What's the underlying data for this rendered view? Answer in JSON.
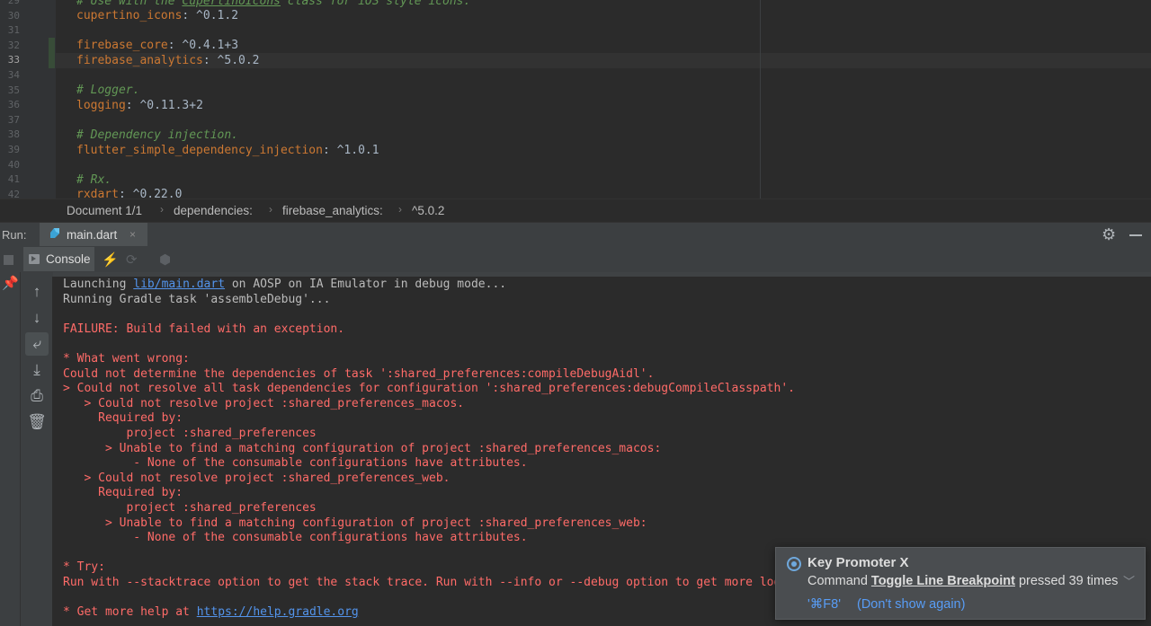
{
  "editor": {
    "lines": [
      {
        "no": "29",
        "parts": [
          {
            "t": "# Use with the ",
            "c": "c"
          },
          {
            "t": "CupertinoIcons",
            "c": "c",
            "u": true
          },
          {
            "t": " class for iOS style icons.",
            "c": "c"
          }
        ]
      },
      {
        "no": "30",
        "parts": [
          {
            "t": "cupertino_icons",
            "c": "k"
          },
          {
            "t": ": ^0.1.2",
            "c": "v"
          }
        ]
      },
      {
        "no": "31",
        "parts": []
      },
      {
        "no": "32",
        "parts": [
          {
            "t": "firebase_core",
            "c": "k"
          },
          {
            "t": ": ^0.4.1+3",
            "c": "v"
          }
        ]
      },
      {
        "no": "33",
        "parts": [
          {
            "t": "firebase_analytics",
            "c": "k"
          },
          {
            "t": ": ^5.0.2",
            "c": "v"
          }
        ],
        "current": true
      },
      {
        "no": "34",
        "parts": []
      },
      {
        "no": "35",
        "parts": [
          {
            "t": "# Logger.",
            "c": "c"
          }
        ]
      },
      {
        "no": "36",
        "parts": [
          {
            "t": "logging",
            "c": "k"
          },
          {
            "t": ": ^0.11.3+2",
            "c": "v"
          }
        ]
      },
      {
        "no": "37",
        "parts": []
      },
      {
        "no": "38",
        "parts": [
          {
            "t": "# Dependency injection.",
            "c": "c"
          }
        ]
      },
      {
        "no": "39",
        "parts": [
          {
            "t": "flutter_simple_dependency_injection",
            "c": "k"
          },
          {
            "t": ": ^1.0.1",
            "c": "v"
          }
        ]
      },
      {
        "no": "40",
        "parts": []
      },
      {
        "no": "41",
        "parts": [
          {
            "t": "# Rx.",
            "c": "c"
          }
        ]
      },
      {
        "no": "42",
        "parts": [
          {
            "t": "rxdart",
            "c": "k"
          },
          {
            "t": ": ^0.22.0",
            "c": "v"
          }
        ]
      }
    ]
  },
  "breadcrumb": {
    "items": [
      "Document 1/1",
      "dependencies:",
      "firebase_analytics:",
      "^5.0.2"
    ],
    "separator": "›"
  },
  "run_panel": {
    "label": "Run:",
    "tab_name": "main.dart",
    "close_glyph": "×",
    "console_tab": "Console"
  },
  "console": {
    "lines": [
      {
        "t": "n",
        "parts": [
          {
            "t": "Launching "
          },
          {
            "t": "lib/main.dart",
            "link": true
          },
          {
            "t": " on AOSP on IA Emulator in debug mode..."
          }
        ]
      },
      {
        "t": "n",
        "parts": [
          {
            "t": "Running Gradle task 'assembleDebug'..."
          }
        ]
      },
      {
        "t": "n",
        "parts": []
      },
      {
        "t": "e",
        "parts": [
          {
            "t": "FAILURE: Build failed with an exception."
          }
        ]
      },
      {
        "t": "e",
        "parts": []
      },
      {
        "t": "e",
        "parts": [
          {
            "t": "* What went wrong:"
          }
        ]
      },
      {
        "t": "e",
        "parts": [
          {
            "t": "Could not determine the dependencies of task ':shared_preferences:compileDebugAidl'."
          }
        ]
      },
      {
        "t": "e",
        "parts": [
          {
            "t": "> Could not resolve all task dependencies for configuration ':shared_preferences:debugCompileClasspath'."
          }
        ]
      },
      {
        "t": "e",
        "parts": [
          {
            "t": "   > Could not resolve project :shared_preferences_macos."
          }
        ]
      },
      {
        "t": "e",
        "parts": [
          {
            "t": "     Required by:"
          }
        ]
      },
      {
        "t": "e",
        "parts": [
          {
            "t": "         project :shared_preferences"
          }
        ]
      },
      {
        "t": "e",
        "parts": [
          {
            "t": "      > Unable to find a matching configuration of project :shared_preferences_macos:"
          }
        ]
      },
      {
        "t": "e",
        "parts": [
          {
            "t": "          - None of the consumable configurations have attributes."
          }
        ]
      },
      {
        "t": "e",
        "parts": [
          {
            "t": "   > Could not resolve project :shared_preferences_web."
          }
        ]
      },
      {
        "t": "e",
        "parts": [
          {
            "t": "     Required by:"
          }
        ]
      },
      {
        "t": "e",
        "parts": [
          {
            "t": "         project :shared_preferences"
          }
        ]
      },
      {
        "t": "e",
        "parts": [
          {
            "t": "      > Unable to find a matching configuration of project :shared_preferences_web:"
          }
        ]
      },
      {
        "t": "e",
        "parts": [
          {
            "t": "          - None of the consumable configurations have attributes."
          }
        ]
      },
      {
        "t": "e",
        "parts": []
      },
      {
        "t": "e",
        "parts": [
          {
            "t": "* Try:"
          }
        ]
      },
      {
        "t": "e",
        "parts": [
          {
            "t": "Run with --stacktrace option to get the stack trace. Run with --info or --debug option to get more log output."
          }
        ]
      },
      {
        "t": "e",
        "parts": []
      },
      {
        "t": "e",
        "parts": [
          {
            "t": "* Get more help at "
          },
          {
            "t": "https://help.gradle.org",
            "link": true
          }
        ]
      }
    ]
  },
  "popup": {
    "title": "Key Promoter X",
    "msg_prefix": "Command ",
    "command": "Toggle Line Breakpoint",
    "msg_suffix": " pressed 39 times",
    "shortcut": "'⌘F8'",
    "dismiss": "(Don't show again)"
  },
  "colors": {
    "background": "#2b2b2b",
    "keyword": "#cc7832",
    "comment": "#629755",
    "error": "#ff6b68",
    "link": "#5394ec"
  }
}
